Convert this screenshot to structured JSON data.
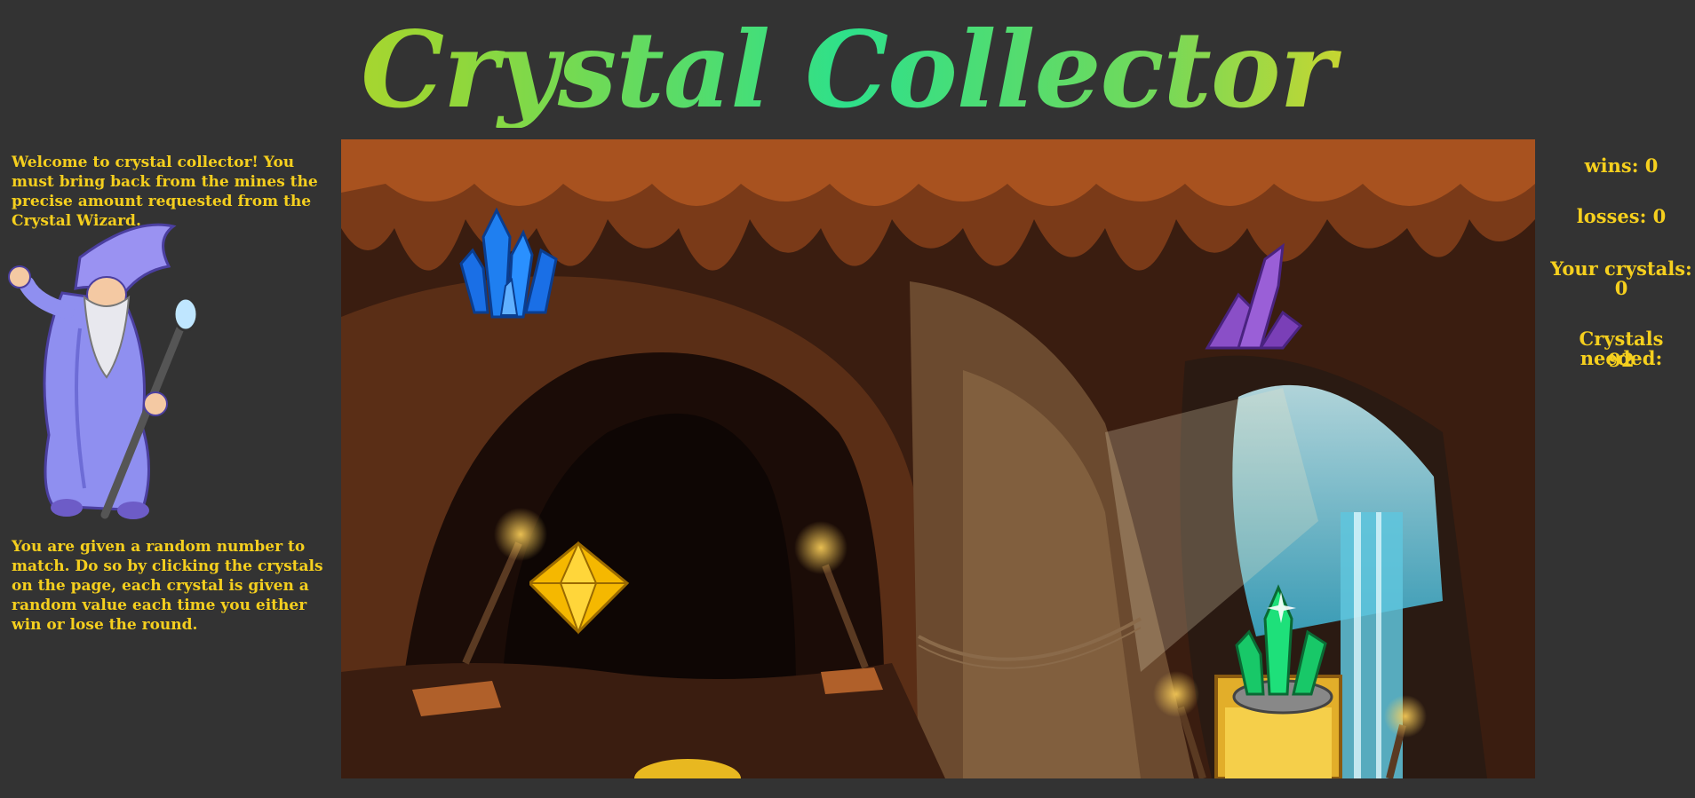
{
  "title": "Crystal Collector",
  "intro": "Welcome to crystal collector! You must bring back from the mines the precise amount requested from the Crystal Wizard.",
  "instructions": "You are given a random number to match. Do so by clicking the crystals on the page, each crystal is given a random value each time you either win or lose the round.",
  "stats": {
    "wins": "wins: 0",
    "losses": "losses: 0",
    "your_crystals_label": "Your crystals:",
    "your_crystals_value": "0",
    "needed_label": "Crystals needed:",
    "needed_value": "92"
  },
  "colors": {
    "background": "#333333",
    "text": "#f5cf1e"
  },
  "crystals": [
    {
      "name": "blue-crystal",
      "color": "#1a6fe6"
    },
    {
      "name": "purple-crystal",
      "color": "#8a4fc7"
    },
    {
      "name": "yellow-crystal",
      "color": "#f5b800"
    },
    {
      "name": "green-crystal",
      "color": "#1ee07a"
    }
  ]
}
